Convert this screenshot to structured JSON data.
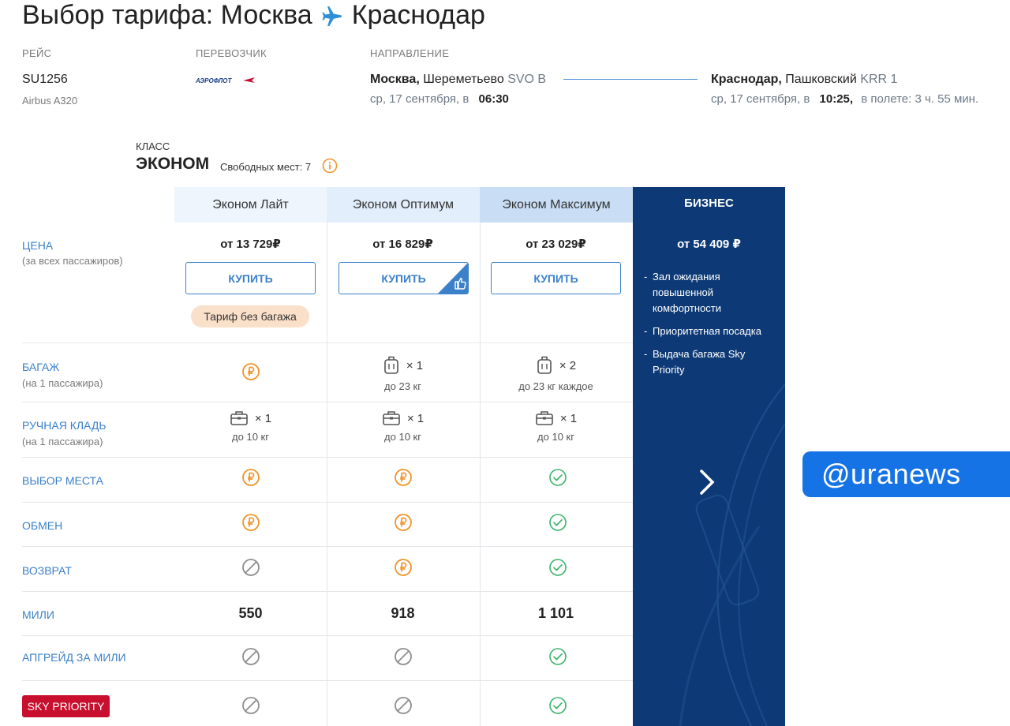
{
  "title": {
    "from": "Выбор тарифа: Москва",
    "to": "Краснодар"
  },
  "flight": {
    "label_flight": "РЕЙС",
    "number": "SU1256",
    "aircraft": "Airbus A320",
    "label_carrier": "ПЕРЕВОЗЧИК",
    "carrier_logo_text": "АЭРОФЛОТ",
    "label_direction": "НАПРАВЛЕНИЕ",
    "dep_city": "Москва,",
    "dep_airport": "Шереметьево",
    "dep_code": "SVO B",
    "dep_date": "ср, 17 сентября, в",
    "dep_time": "06:30",
    "arr_city": "Краснодар,",
    "arr_airport": "Пашковский",
    "arr_code": "KRR 1",
    "arr_date": "ср, 17 сентября, в",
    "arr_time": "10:25,",
    "duration": "в полете: 3 ч. 55 мин."
  },
  "cabin": {
    "label": "КЛАСС",
    "name": "ЭКОНОМ",
    "seats": "Свободных мест: 7"
  },
  "tariffs": [
    {
      "name": "Эконом Лайт",
      "price": "от 13 729₽",
      "buy": "КУПИТЬ",
      "badge": "Тариф без багажа",
      "baggage_qty": "",
      "baggage_note": "",
      "hand_qty": "× 1",
      "hand_note": "до 10 кг",
      "miles": "550"
    },
    {
      "name": "Эконом Оптимум",
      "price": "от 16 829₽",
      "buy": "КУПИТЬ",
      "baggage_qty": "× 1",
      "baggage_note": "до 23 кг",
      "hand_qty": "× 1",
      "hand_note": "до 10 кг",
      "miles": "918"
    },
    {
      "name": "Эконом Максимум",
      "price": "от 23 029₽",
      "buy": "КУПИТЬ",
      "baggage_qty": "× 2",
      "baggage_note": "до 23 кг каждое",
      "hand_qty": "× 1",
      "hand_note": "до 10 кг",
      "miles": "1 101"
    }
  ],
  "business": {
    "name": "БИЗНЕС",
    "price": "от 54 409 ₽",
    "features": [
      "Зал ожидания повышенной комфортности",
      "Приоритетная посадка",
      "Выдача багажа Sky Priority"
    ]
  },
  "rows": {
    "price": {
      "title": "ЦЕНА",
      "sub": "(за всех пассажиров)"
    },
    "baggage": {
      "title": "БАГАЖ",
      "sub": "(на 1 пассажира)"
    },
    "hand": {
      "title": "РУЧНАЯ КЛАДЬ",
      "sub": "(на 1 пассажира)"
    },
    "seat": {
      "title": "ВЫБОР МЕСТА"
    },
    "exchange": {
      "title": "ОБМЕН"
    },
    "refund": {
      "title": "ВОЗВРАТ"
    },
    "miles": {
      "title": "МИЛИ"
    },
    "upgrade": {
      "title": "АПГРЕЙД ЗА МИЛИ"
    },
    "sky": {
      "title": "SKY PRIORITY"
    }
  },
  "features_matrix": {
    "seat": [
      "paid",
      "paid",
      "included"
    ],
    "exchange": [
      "paid",
      "paid",
      "included"
    ],
    "refund": [
      "unavailable",
      "paid",
      "included"
    ],
    "upgrade": [
      "unavailable",
      "unavailable",
      "included"
    ],
    "sky": [
      "unavailable",
      "unavailable",
      "included"
    ]
  },
  "watermark": "@uranews",
  "colors": {
    "accent": "#3b80c9",
    "paid": "#f0952b",
    "included": "#3bb36a",
    "unavailable": "#8d8d8d",
    "business_bg": "#0d3a77",
    "sky_priority": "#c8102e"
  }
}
